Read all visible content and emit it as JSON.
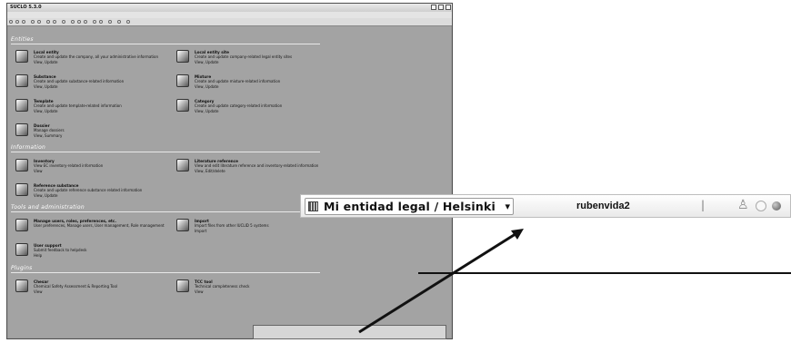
{
  "window": {
    "title": "SUCLO 5.3.0",
    "menu": [
      "File",
      "Edit",
      "Go",
      "Window",
      "Help",
      "Plastic"
    ]
  },
  "sections": [
    {
      "title": "Entities",
      "items": [
        {
          "title": "Local entity",
          "desc": "Create and update the company, all your administrative information",
          "links": "View, Update"
        },
        {
          "title": "Local entity site",
          "desc": "Create and update company-related legal entity sites",
          "links": "View, Update"
        },
        {
          "title": "Substance",
          "desc": "Create and update substance-related information",
          "links": "View, Update"
        },
        {
          "title": "Mixture",
          "desc": "Create and update mixture-related information",
          "links": "View, Update"
        },
        {
          "title": "Template",
          "desc": "Create and update template-related information",
          "links": "View, Update"
        },
        {
          "title": "Category",
          "desc": "Create and update category-related information",
          "links": "View, Update"
        },
        {
          "title": "Dossier",
          "desc": "Manage dossiers",
          "links": "View, Summary"
        }
      ]
    },
    {
      "title": "Information",
      "items": [
        {
          "title": "Inventory",
          "desc": "View EC inventory-related information",
          "links": "View"
        },
        {
          "title": "Literature reference",
          "desc": "View and edit literature reference and inventory-related information",
          "links": "View, Edit/delete"
        },
        {
          "title": "Reference substance",
          "desc": "Create and update reference substance related information",
          "links": "View, Update"
        }
      ]
    },
    {
      "title": "Tools and administration",
      "items": [
        {
          "title": "Manage users, roles, preferences, etc.",
          "desc": "User preferences, Manage users, User management, Role management",
          "links": ""
        },
        {
          "title": "Import",
          "desc": "Import files from other IUCLID 5 systems",
          "links": "Import"
        },
        {
          "title": "User support",
          "desc": "Submit feedback to helpdesk",
          "links": "Help"
        }
      ]
    },
    {
      "title": "Plugins",
      "items": [
        {
          "title": "Chesar",
          "desc": "Chemical Safety Assessment & Reporting Tool",
          "links": "View"
        },
        {
          "title": "TCC tool",
          "desc": "Technical completeness check",
          "links": "View"
        }
      ]
    }
  ],
  "zoom": {
    "entity": "Mi entidad legal / Helsinki / Finla",
    "user": "rubenvida2",
    "separator": "|"
  }
}
